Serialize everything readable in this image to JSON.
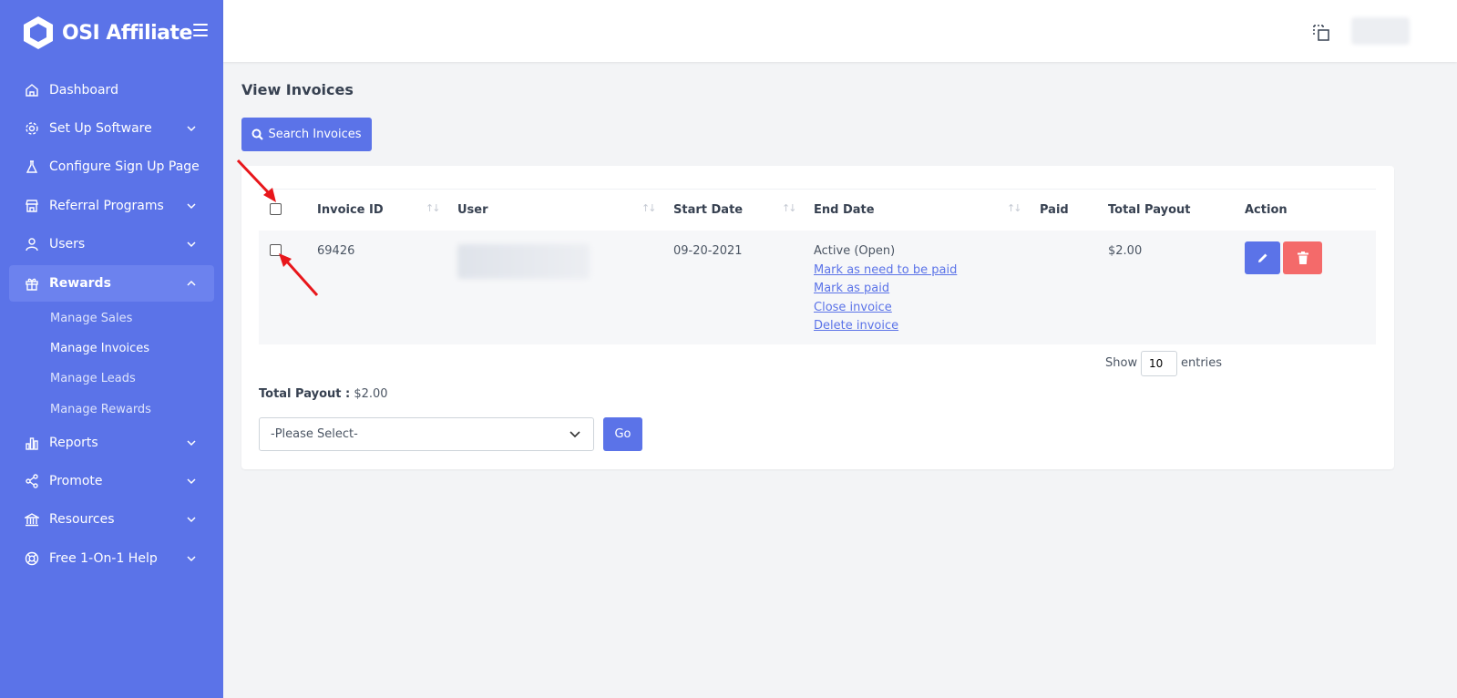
{
  "brand": {
    "name": "OSI Affiliate"
  },
  "sidebar": {
    "items": [
      {
        "label": "Dashboard",
        "icon": "home-icon"
      },
      {
        "label": "Set Up Software",
        "icon": "gear-icon",
        "expandable": true
      },
      {
        "label": "Configure Sign Up Page",
        "icon": "flask-icon"
      },
      {
        "label": "Referral Programs",
        "icon": "store-icon",
        "expandable": true
      },
      {
        "label": "Users",
        "icon": "user-icon",
        "expandable": true
      },
      {
        "label": "Rewards",
        "icon": "gift-icon",
        "expandable": true,
        "expanded": true
      },
      {
        "label": "Reports",
        "icon": "bar-chart-icon",
        "expandable": true
      },
      {
        "label": "Promote",
        "icon": "share-icon",
        "expandable": true
      },
      {
        "label": "Resources",
        "icon": "bank-icon",
        "expandable": true
      },
      {
        "label": "Free 1-On-1 Help",
        "icon": "lifebuoy-icon",
        "expandable": true
      }
    ],
    "rewards_sub": [
      {
        "label": "Manage Sales"
      },
      {
        "label": "Manage Invoices",
        "current": true
      },
      {
        "label": "Manage Leads"
      },
      {
        "label": "Manage Rewards"
      }
    ]
  },
  "page": {
    "title": "View Invoices",
    "search_button": "Search Invoices"
  },
  "table": {
    "columns": [
      "Invoice ID",
      "User",
      "Start Date",
      "End Date",
      "Paid",
      "Total Payout",
      "Action"
    ],
    "rows": [
      {
        "invoice_id": "69426",
        "user": "",
        "start_date": "09-20-2021",
        "end_date_status": "Active (Open)",
        "links": [
          "Mark as need to be paid",
          "Mark as paid",
          "Close invoice",
          "Delete invoice"
        ],
        "paid": "",
        "total_payout": "$2.00"
      }
    ]
  },
  "pagination": {
    "show_label": "Show",
    "entries_value": "10",
    "entries_label": "entries"
  },
  "summary": {
    "total_payout_label": "Total Payout :",
    "total_payout_value": "$2.00"
  },
  "bulk_action": {
    "selected": "-Please Select-",
    "go_label": "Go"
  },
  "colors": {
    "primary": "#5b73e8",
    "danger": "#f46a6a",
    "annotation": "#e8161b"
  }
}
